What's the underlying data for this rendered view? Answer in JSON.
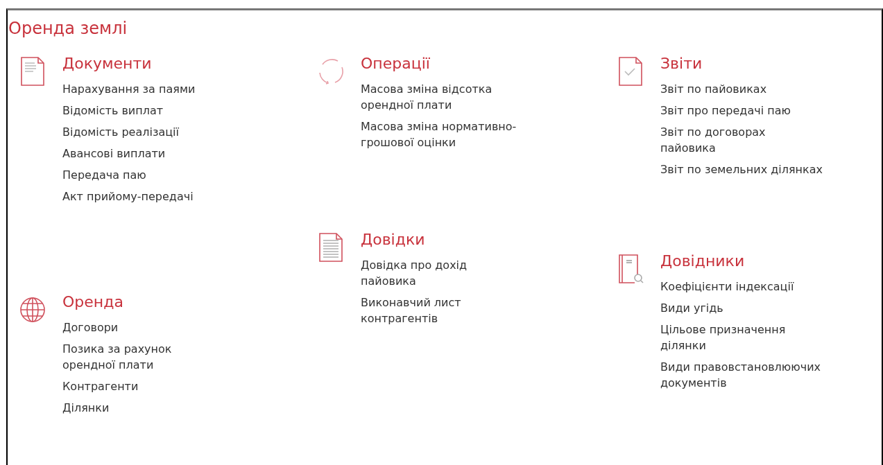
{
  "title": "Оренда землі",
  "columns": [
    {
      "sections": [
        {
          "title": "Документи",
          "items": [
            {
              "lines": [
                "Нарахування за паями"
              ]
            },
            {
              "lines": [
                "Відомість виплат"
              ]
            },
            {
              "lines": [
                "Відомість реалізації"
              ]
            },
            {
              "lines": [
                "Авансові виплати"
              ]
            },
            {
              "lines": [
                "Передача паю"
              ]
            },
            {
              "lines": [
                "Акт прийому-передачі"
              ]
            }
          ]
        },
        {
          "title": "Оренда",
          "items": [
            {
              "lines": [
                "Договори"
              ]
            },
            {
              "lines": [
                "Позика за рахунок",
                "орендної плати"
              ]
            },
            {
              "lines": [
                "Контрагенти"
              ]
            },
            {
              "lines": [
                "Ділянки"
              ]
            }
          ]
        }
      ]
    },
    {
      "sections": [
        {
          "title": "Операції",
          "items": [
            {
              "lines": [
                "Масова зміна відсотка",
                "орендної плати"
              ]
            },
            {
              "lines": [
                "Масова зміна нормативно-",
                "грошової оцінки"
              ]
            }
          ]
        },
        {
          "title": "Довідки",
          "items": [
            {
              "lines": [
                "Довідка про дохід",
                "пайовика"
              ]
            },
            {
              "lines": [
                "Виконавчий лист",
                "контрагентів"
              ]
            }
          ]
        }
      ]
    },
    {
      "sections": [
        {
          "title": "Звіти",
          "items": [
            {
              "lines": [
                "Звіт по пайовиках"
              ]
            },
            {
              "lines": [
                "Звіт про передачі паю"
              ]
            },
            {
              "lines": [
                "Звіт по договорах",
                "пайовика"
              ]
            },
            {
              "lines": [
                "Звіт по земельних ділянках"
              ]
            }
          ]
        },
        {
          "title": "Довідники",
          "items": [
            {
              "lines": [
                "Коефіцієнти індексації"
              ]
            },
            {
              "lines": [
                "Види угідь"
              ]
            },
            {
              "lines": [
                "Цільове призначення",
                "ділянки"
              ]
            },
            {
              "lines": [
                "Види правовстановлюючих",
                "документів"
              ]
            }
          ]
        }
      ]
    }
  ]
}
